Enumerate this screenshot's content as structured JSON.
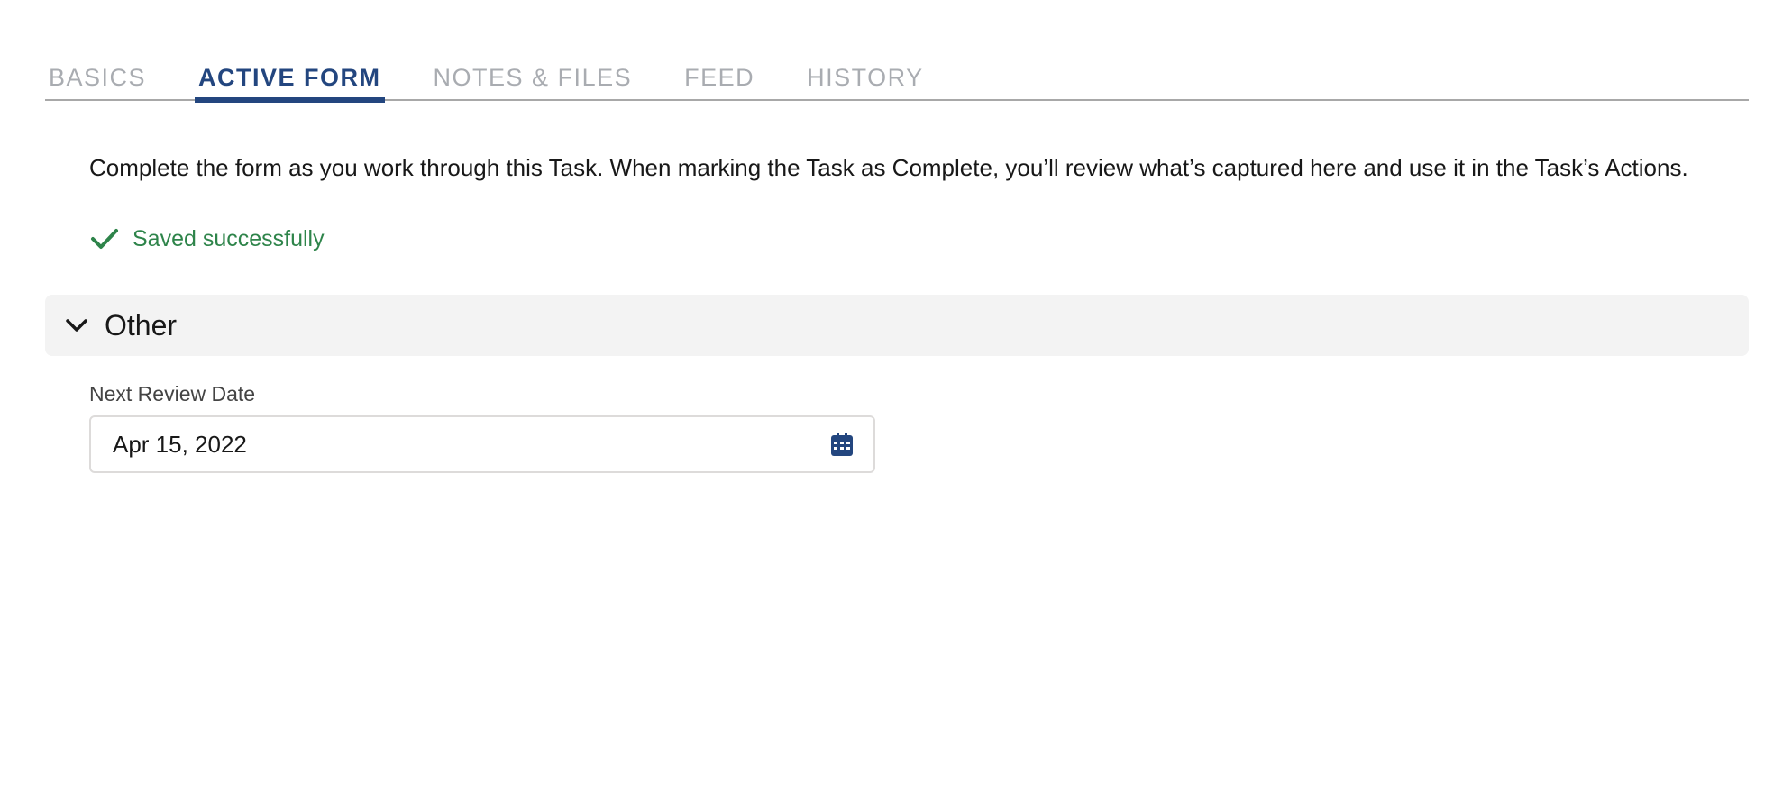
{
  "tabs": [
    {
      "label": "BASICS",
      "active": false
    },
    {
      "label": "ACTIVE FORM",
      "active": true
    },
    {
      "label": "NOTES & FILES",
      "active": false
    },
    {
      "label": "FEED",
      "active": false
    },
    {
      "label": "HISTORY",
      "active": false
    }
  ],
  "form": {
    "intro": "Complete the form as you work through this Task. When marking the Task as Complete, you’ll review what’s captured here and use it in the Task’s Actions.",
    "save_status": "Saved successfully",
    "section": {
      "title": "Other",
      "expanded": true,
      "fields": [
        {
          "label": "Next Review Date",
          "value": "Apr 15, 2022",
          "icon": "calendar-icon"
        }
      ]
    }
  },
  "colors": {
    "accent": "#23467f",
    "success": "#2e844a",
    "inactive_tab": "#a9acb1",
    "section_bg": "#f3f3f3"
  }
}
